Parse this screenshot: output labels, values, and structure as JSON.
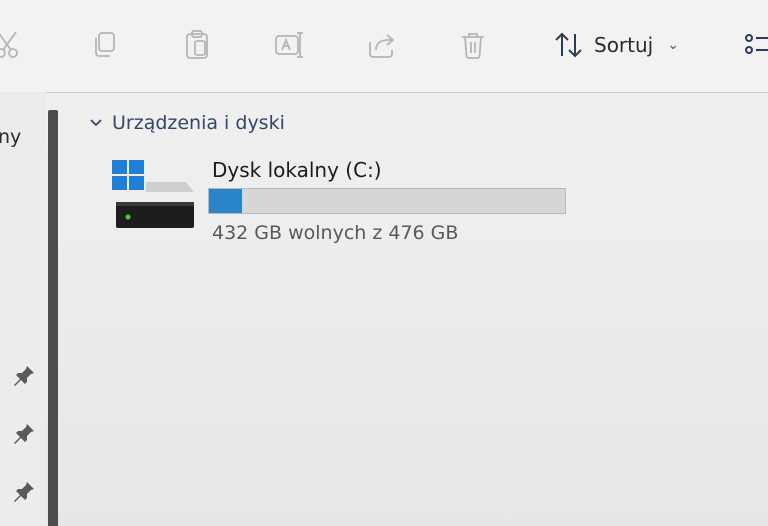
{
  "toolbar": {
    "icons": [
      "scissors-icon",
      "copy-icon",
      "paste-icon",
      "rename-icon",
      "share-icon",
      "trash-icon"
    ],
    "sort_label": "Sortuj",
    "sort_icon": "sort-up-down-icon",
    "view_icon": "view-options-icon"
  },
  "nav": {
    "partial_label": "ny",
    "pins": [
      "pin-icon",
      "pin-icon",
      "pin-icon"
    ]
  },
  "group": {
    "title": "Urządzenia i dyski"
  },
  "drive": {
    "name": "Dysk lokalny (C:)",
    "space_text": "432 GB wolnych z 476 GB",
    "used_fraction": 0.0924,
    "bar_color": "#2a84c9",
    "icon": "windows-drive-icon"
  },
  "colors": {
    "accent": "#2a84c9",
    "windows_logo": "#1f7ed6",
    "group_title": "#34466b"
  }
}
